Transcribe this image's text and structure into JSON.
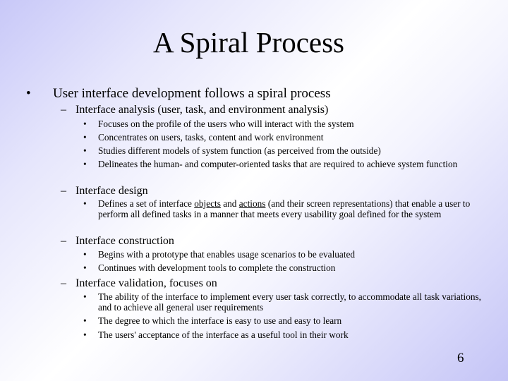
{
  "slide": {
    "title": "A Spiral Process",
    "page_number": "6",
    "bullet_glyph": "•",
    "dash_glyph": "–",
    "main_point": "User interface development follows a spiral process",
    "sections": [
      {
        "heading": "Interface analysis (user, task, and environment analysis)",
        "items": [
          "Focuses on the profile of the users who will interact with the system",
          "Concentrates on users, tasks, content and work environment",
          "Studies different models of system function (as perceived from the outside)",
          "Delineates the human- and computer-oriented tasks that are required to achieve system function"
        ]
      },
      {
        "heading": "Interface design",
        "items": [
          {
            "pre": "Defines a set of interface ",
            "u1": "objects",
            "mid": " and ",
            "u2": "actions",
            "post": " (and their screen representations) that enable a user to perform all defined tasks in a manner that meets every usability goal defined for the system"
          }
        ]
      },
      {
        "heading": "Interface construction",
        "items": [
          "Begins with a prototype that enables usage scenarios to be evaluated",
          "Continues with development tools to complete the construction"
        ]
      },
      {
        "heading": "Interface validation, focuses on",
        "items": [
          "The ability of the interface to implement every user task correctly, to accommodate all task variations, and to achieve all general user requirements",
          "The degree to which the interface is easy to use and easy to learn",
          "The users' acceptance of the interface as a useful tool in their work"
        ]
      }
    ]
  }
}
